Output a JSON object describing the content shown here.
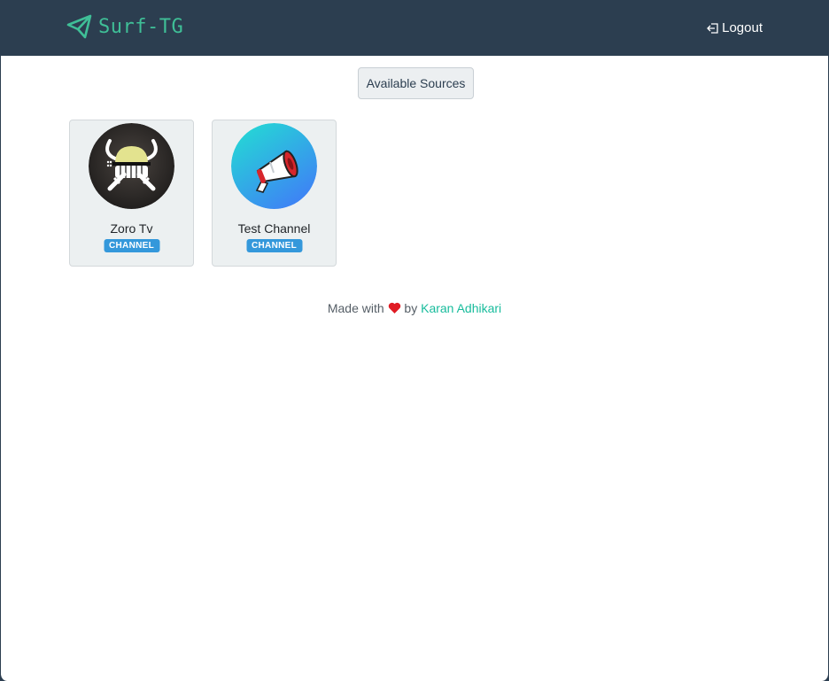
{
  "navbar": {
    "brand": "Surf-TG",
    "brand_icon": "telegram-plane-icon",
    "logout_label": "Logout",
    "logout_icon": "logout-icon"
  },
  "main": {
    "sources_button": "Available Sources",
    "cards": [
      {
        "name": "Zoro Tv",
        "badge": "CHANNEL",
        "avatar": "zoro-logo"
      },
      {
        "name": "Test Channel",
        "badge": "CHANNEL",
        "avatar": "megaphone-icon"
      }
    ]
  },
  "footer": {
    "made_with": "Made with",
    "by": "by",
    "author": "Karan Adhikari"
  },
  "colors": {
    "navbar": "#2c3e50",
    "brand": "#3fbf97",
    "badge": "#3498db",
    "link": "#18bc9c",
    "heart": "#e01b24"
  }
}
